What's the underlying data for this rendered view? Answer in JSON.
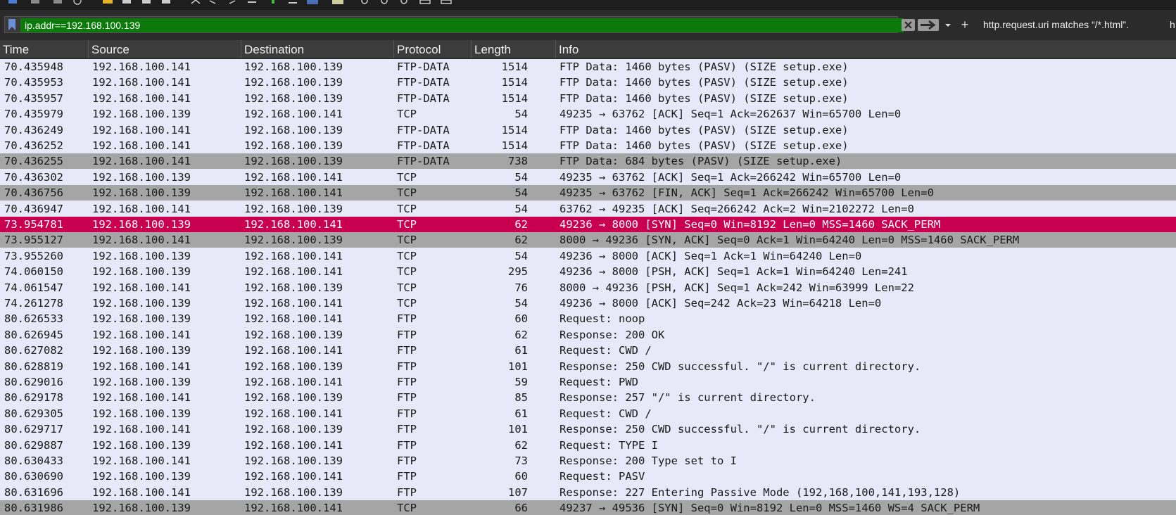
{
  "filter": {
    "value": "ip.addr==192.168.100.139",
    "saved_filter_1": "http.request.uri matches “/*.html”.",
    "saved_filter_2": "h"
  },
  "columns": [
    "Time",
    "Source",
    "Destination",
    "Protocol",
    "Length",
    "Info"
  ],
  "colors": {
    "default_row": "#e8e8f8",
    "gray_row": "#a5a5a5",
    "selected_row": "#c8004f",
    "filter_green": "#0b7a0b"
  },
  "packets": [
    {
      "time": "70.435948",
      "src": "192.168.100.141",
      "dst": "192.168.100.139",
      "proto": "FTP-DATA",
      "len": "1514",
      "info": "FTP Data: 1460 bytes (PASV) (SIZE setup.exe)",
      "style": "default"
    },
    {
      "time": "70.435953",
      "src": "192.168.100.141",
      "dst": "192.168.100.139",
      "proto": "FTP-DATA",
      "len": "1514",
      "info": "FTP Data: 1460 bytes (PASV) (SIZE setup.exe)",
      "style": "default"
    },
    {
      "time": "70.435957",
      "src": "192.168.100.141",
      "dst": "192.168.100.139",
      "proto": "FTP-DATA",
      "len": "1514",
      "info": "FTP Data: 1460 bytes (PASV) (SIZE setup.exe)",
      "style": "default"
    },
    {
      "time": "70.435979",
      "src": "192.168.100.139",
      "dst": "192.168.100.141",
      "proto": "TCP",
      "len": "54",
      "info": "49235 → 63762 [ACK] Seq=1 Ack=262637 Win=65700 Len=0",
      "style": "default"
    },
    {
      "time": "70.436249",
      "src": "192.168.100.141",
      "dst": "192.168.100.139",
      "proto": "FTP-DATA",
      "len": "1514",
      "info": "FTP Data: 1460 bytes (PASV) (SIZE setup.exe)",
      "style": "default"
    },
    {
      "time": "70.436252",
      "src": "192.168.100.141",
      "dst": "192.168.100.139",
      "proto": "FTP-DATA",
      "len": "1514",
      "info": "FTP Data: 1460 bytes (PASV) (SIZE setup.exe)",
      "style": "default"
    },
    {
      "time": "70.436255",
      "src": "192.168.100.141",
      "dst": "192.168.100.139",
      "proto": "FTP-DATA",
      "len": "738",
      "info": "FTP Data: 684 bytes (PASV) (SIZE setup.exe)",
      "style": "gray"
    },
    {
      "time": "70.436302",
      "src": "192.168.100.139",
      "dst": "192.168.100.141",
      "proto": "TCP",
      "len": "54",
      "info": "49235 → 63762 [ACK] Seq=1 Ack=266242 Win=65700 Len=0",
      "style": "default"
    },
    {
      "time": "70.436756",
      "src": "192.168.100.139",
      "dst": "192.168.100.141",
      "proto": "TCP",
      "len": "54",
      "info": "49235 → 63762 [FIN, ACK] Seq=1 Ack=266242 Win=65700 Len=0",
      "style": "gray"
    },
    {
      "time": "70.436947",
      "src": "192.168.100.141",
      "dst": "192.168.100.139",
      "proto": "TCP",
      "len": "54",
      "info": "63762 → 49235 [ACK] Seq=266242 Ack=2 Win=2102272 Len=0",
      "style": "default"
    },
    {
      "time": "73.954781",
      "src": "192.168.100.139",
      "dst": "192.168.100.141",
      "proto": "TCP",
      "len": "62",
      "info": "49236 → 8000 [SYN] Seq=0 Win=8192 Len=0 MSS=1460 SACK_PERM",
      "style": "selected"
    },
    {
      "time": "73.955127",
      "src": "192.168.100.141",
      "dst": "192.168.100.139",
      "proto": "TCP",
      "len": "62",
      "info": "8000 → 49236 [SYN, ACK] Seq=0 Ack=1 Win=64240 Len=0 MSS=1460 SACK_PERM",
      "style": "gray"
    },
    {
      "time": "73.955260",
      "src": "192.168.100.139",
      "dst": "192.168.100.141",
      "proto": "TCP",
      "len": "54",
      "info": "49236 → 8000 [ACK] Seq=1 Ack=1 Win=64240 Len=0",
      "style": "default"
    },
    {
      "time": "74.060150",
      "src": "192.168.100.139",
      "dst": "192.168.100.141",
      "proto": "TCP",
      "len": "295",
      "info": "49236 → 8000 [PSH, ACK] Seq=1 Ack=1 Win=64240 Len=241",
      "style": "default"
    },
    {
      "time": "74.061547",
      "src": "192.168.100.141",
      "dst": "192.168.100.139",
      "proto": "TCP",
      "len": "76",
      "info": "8000 → 49236 [PSH, ACK] Seq=1 Ack=242 Win=63999 Len=22",
      "style": "default"
    },
    {
      "time": "74.261278",
      "src": "192.168.100.139",
      "dst": "192.168.100.141",
      "proto": "TCP",
      "len": "54",
      "info": "49236 → 8000 [ACK] Seq=242 Ack=23 Win=64218 Len=0",
      "style": "default"
    },
    {
      "time": "80.626533",
      "src": "192.168.100.139",
      "dst": "192.168.100.141",
      "proto": "FTP",
      "len": "60",
      "info": "Request: noop",
      "style": "default"
    },
    {
      "time": "80.626945",
      "src": "192.168.100.141",
      "dst": "192.168.100.139",
      "proto": "FTP",
      "len": "62",
      "info": "Response: 200 OK",
      "style": "default"
    },
    {
      "time": "80.627082",
      "src": "192.168.100.139",
      "dst": "192.168.100.141",
      "proto": "FTP",
      "len": "61",
      "info": "Request: CWD /",
      "style": "default"
    },
    {
      "time": "80.628819",
      "src": "192.168.100.141",
      "dst": "192.168.100.139",
      "proto": "FTP",
      "len": "101",
      "info": "Response: 250 CWD successful. \"/\" is current directory.",
      "style": "default"
    },
    {
      "time": "80.629016",
      "src": "192.168.100.139",
      "dst": "192.168.100.141",
      "proto": "FTP",
      "len": "59",
      "info": "Request: PWD",
      "style": "default"
    },
    {
      "time": "80.629178",
      "src": "192.168.100.141",
      "dst": "192.168.100.139",
      "proto": "FTP",
      "len": "85",
      "info": "Response: 257 \"/\" is current directory.",
      "style": "default"
    },
    {
      "time": "80.629305",
      "src": "192.168.100.139",
      "dst": "192.168.100.141",
      "proto": "FTP",
      "len": "61",
      "info": "Request: CWD /",
      "style": "default"
    },
    {
      "time": "80.629717",
      "src": "192.168.100.141",
      "dst": "192.168.100.139",
      "proto": "FTP",
      "len": "101",
      "info": "Response: 250 CWD successful. \"/\" is current directory.",
      "style": "default"
    },
    {
      "time": "80.629887",
      "src": "192.168.100.139",
      "dst": "192.168.100.141",
      "proto": "FTP",
      "len": "62",
      "info": "Request: TYPE I",
      "style": "default"
    },
    {
      "time": "80.630433",
      "src": "192.168.100.141",
      "dst": "192.168.100.139",
      "proto": "FTP",
      "len": "73",
      "info": "Response: 200 Type set to I",
      "style": "default"
    },
    {
      "time": "80.630690",
      "src": "192.168.100.139",
      "dst": "192.168.100.141",
      "proto": "FTP",
      "len": "60",
      "info": "Request: PASV",
      "style": "default"
    },
    {
      "time": "80.631696",
      "src": "192.168.100.141",
      "dst": "192.168.100.139",
      "proto": "FTP",
      "len": "107",
      "info": "Response: 227 Entering Passive Mode (192,168,100,141,193,128)",
      "style": "default"
    },
    {
      "time": "80.631986",
      "src": "192.168.100.139",
      "dst": "192.168.100.141",
      "proto": "TCP",
      "len": "66",
      "info": "49237 → 49536 [SYN] Seq=0 Win=8192 Len=0 MSS=1460 WS=4 SACK_PERM",
      "style": "gray"
    }
  ]
}
